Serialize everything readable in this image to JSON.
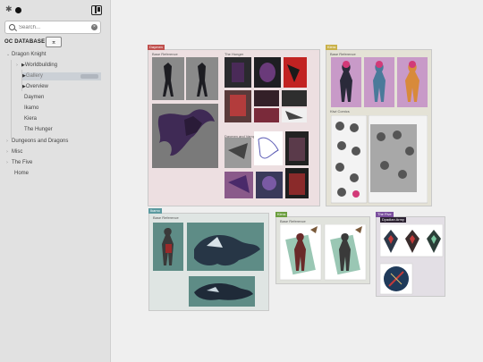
{
  "sidebar": {
    "search_placeholder": "Search...",
    "db_title": "OC DATABASE",
    "db_toggle_icon": "collapse-icon",
    "items": [
      {
        "label": "Dragon Knight"
      },
      {
        "label": "Worldbuilding"
      },
      {
        "label": "Gallery"
      },
      {
        "label": "Overview"
      },
      {
        "label": "Daymen"
      },
      {
        "label": "Ikamo"
      },
      {
        "label": "Kiera"
      },
      {
        "label": "The Hunger"
      },
      {
        "label": "Dungeons and Dragons"
      },
      {
        "label": "Misc"
      },
      {
        "label": "The Five"
      },
      {
        "label": "Home"
      }
    ]
  },
  "canvas": {
    "groups": [
      {
        "tag": "Daymen",
        "tag_color": "#c0504d",
        "sections": [
          "Base Reference",
          "The Hunger",
          "Daymen and Vampel"
        ]
      },
      {
        "tag": "Kiera",
        "tag_color": "#c9b14a",
        "sections": [
          "Base Reference",
          "Kiwi Comics"
        ]
      },
      {
        "tag": "Ikamo",
        "tag_color": "#5b9aa0",
        "sections": [
          "Base Reference"
        ]
      },
      {
        "tag": "Kiera",
        "tag_color": "#6b9e3e",
        "sections": [
          "Base Reference"
        ]
      },
      {
        "tag": "The Five",
        "tag_color": "#7b4f9e",
        "sections": [
          "Dyadian Army"
        ]
      }
    ]
  }
}
